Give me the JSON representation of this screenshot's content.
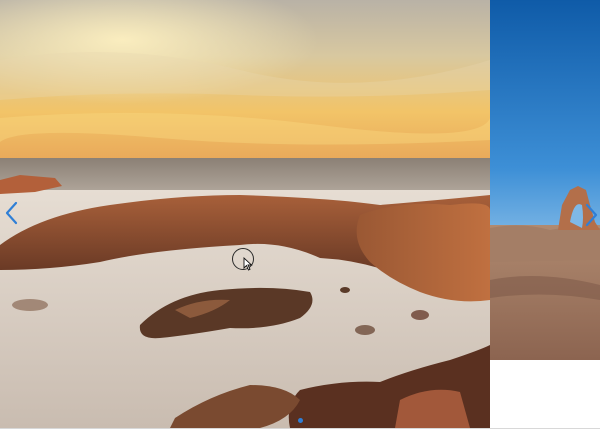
{
  "carousel": {
    "slides": [
      {
        "name": "coastal-sunset-rocks"
      },
      {
        "name": "desert-rock-arch"
      }
    ],
    "prev_icon": "chevron-left-icon",
    "next_icon": "chevron-right-icon"
  },
  "colors": {
    "arrow": "#2f7fd6",
    "sky_warm": "#f5c060",
    "sky_blue": "#1e70c0",
    "rock": "#8a4a2a"
  }
}
